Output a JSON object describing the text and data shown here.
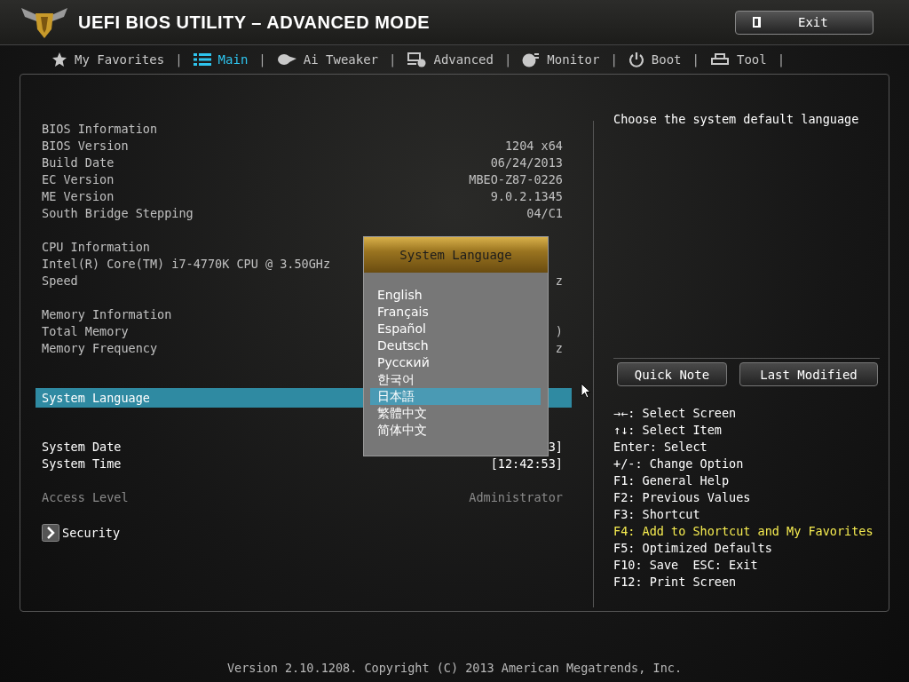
{
  "header": {
    "title": "UEFI BIOS UTILITY – ADVANCED MODE",
    "exit_button": "Exit"
  },
  "tabs": [
    {
      "label": "My Favorites",
      "selected": false
    },
    {
      "label": "Main",
      "selected": true
    },
    {
      "label": "Ai Tweaker",
      "selected": false
    },
    {
      "label": "Advanced",
      "selected": false
    },
    {
      "label": "Monitor",
      "selected": false
    },
    {
      "label": "Boot",
      "selected": false
    },
    {
      "label": "Tool",
      "selected": false
    }
  ],
  "tab_separator": "|",
  "main": {
    "groups": [
      {
        "kind": "info",
        "rows": [
          {
            "kind": "info",
            "label": "BIOS Information",
            "selected": false
          },
          {
            "kind": "info",
            "label": "BIOS Version",
            "value": "1204 x64",
            "selected": false
          },
          {
            "kind": "info",
            "label": "Build Date",
            "value": "06/24/2013",
            "selected": false
          },
          {
            "kind": "info",
            "label": "EC Version",
            "value": "MBEO-Z87-0226",
            "selected": false
          },
          {
            "kind": "info",
            "label": "ME Version",
            "value": "9.0.2.1345",
            "selected": false
          },
          {
            "kind": "info",
            "label": "South Bridge Stepping",
            "value": "04/C1",
            "selected": false
          }
        ]
      },
      {
        "kind": "info",
        "rows": [
          {
            "kind": "info",
            "label": "CPU Information",
            "selected": false
          },
          {
            "kind": "info",
            "label": "Intel(R) Core(TM) i7-4770K CPU @ 3.50GHz",
            "selected": false
          },
          {
            "kind": "info",
            "label": "Speed",
            "value": "z",
            "selected": false
          }
        ]
      },
      {
        "kind": "info",
        "rows": [
          {
            "kind": "info",
            "label": "Memory Information",
            "selected": false
          },
          {
            "kind": "info",
            "label": "Total Memory",
            "value": ")",
            "selected": false
          },
          {
            "kind": "info",
            "label": "Memory Frequency",
            "value": "z",
            "selected": false
          }
        ]
      },
      {
        "kind": "setting",
        "rows": [
          {
            "kind": "setting",
            "label": "System Language",
            "selected": true
          }
        ]
      },
      {
        "kind": "setting",
        "rows": [
          {
            "kind": "setting",
            "label": "System Date",
            "value": "3]",
            "selected": false
          },
          {
            "kind": "setting",
            "label": "System Time",
            "value": "[12:42:53]",
            "selected": false
          }
        ]
      },
      {
        "kind": "info",
        "rows": [
          {
            "kind": "dim",
            "label": "Access Level",
            "value": "Administrator",
            "selected": false
          }
        ]
      },
      {
        "kind": "info",
        "rows": [
          {
            "kind": "submenu",
            "label": "Security",
            "selected": false
          }
        ]
      }
    ]
  },
  "popup": {
    "title": "System Language",
    "options": [
      {
        "label": "English",
        "selected": false
      },
      {
        "label": "Français",
        "selected": false
      },
      {
        "label": "Español",
        "selected": false
      },
      {
        "label": "Deutsch",
        "selected": false
      },
      {
        "label": "Русский",
        "selected": false
      },
      {
        "label": "한국어",
        "selected": false
      },
      {
        "label": "日本語",
        "selected": true
      },
      {
        "label": "繁體中文",
        "selected": false
      },
      {
        "label": "简体中文",
        "selected": false
      }
    ]
  },
  "help": {
    "description": "Choose the system default language",
    "buttons": [
      "Quick Note",
      "Last Modified"
    ],
    "keys": [
      {
        "text": "→←: Select Screen",
        "highlight": false
      },
      {
        "text": "↑↓: Select Item",
        "highlight": false
      },
      {
        "text": "Enter: Select",
        "highlight": false
      },
      {
        "text": "+/-: Change Option",
        "highlight": false
      },
      {
        "text": "F1: General Help",
        "highlight": false
      },
      {
        "text": "F2: Previous Values",
        "highlight": false
      },
      {
        "text": "F3: Shortcut",
        "highlight": false
      },
      {
        "text": "F4: Add to Shortcut and My Favorites",
        "highlight": true
      },
      {
        "text": "F5: Optimized Defaults",
        "highlight": false
      },
      {
        "text": "F10: Save  ESC: Exit",
        "highlight": false
      },
      {
        "text": "F12: Print Screen",
        "highlight": false
      }
    ]
  },
  "footer": "Version 2.10.1208. Copyright (C) 2013 American Megatrends, Inc."
}
